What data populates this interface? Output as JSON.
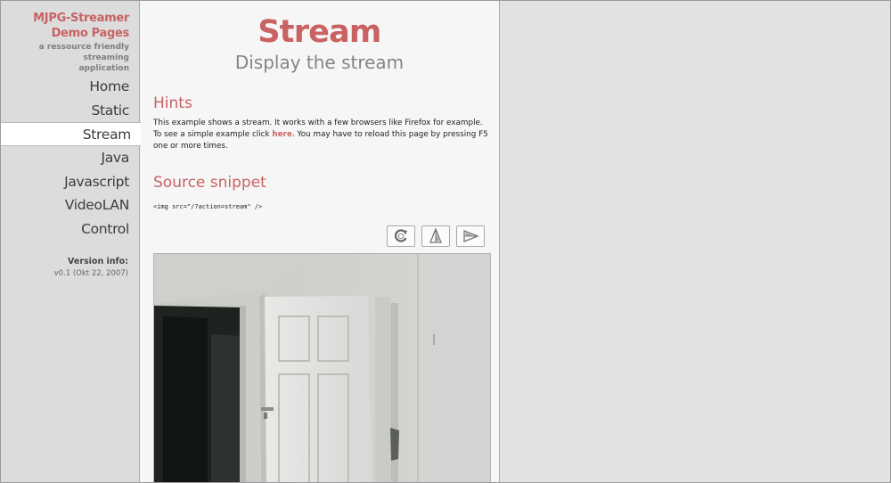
{
  "brand": {
    "title": "MJPG-Streamer\nDemo Pages",
    "subtitle": "a ressource friendly streaming\napplication"
  },
  "nav": {
    "items": [
      {
        "label": "Home"
      },
      {
        "label": "Static"
      },
      {
        "label": "Stream"
      },
      {
        "label": "Java"
      },
      {
        "label": "Javascript"
      },
      {
        "label": "VideoLAN"
      },
      {
        "label": "Control"
      }
    ],
    "active": "Stream"
  },
  "version": {
    "label": "Version info:",
    "value": "v0.1 (Okt 22, 2007)"
  },
  "page": {
    "title": "Stream",
    "subtitle": "Display the stream"
  },
  "hints": {
    "heading": "Hints",
    "text_before": "This example shows a stream. It works with a few browsers like Firefox for example. To see a simple example click ",
    "link": "here",
    "text_after": ". You may have to reload this page by pressing F5 one or more times."
  },
  "snippet": {
    "heading": "Source snippet",
    "code": "<img src=\"/?action=stream\" />"
  },
  "toolbar": {
    "buttons": [
      {
        "icon": "rotate-icon"
      },
      {
        "icon": "flip-vertical-icon"
      },
      {
        "icon": "flip-horizontal-icon"
      }
    ]
  },
  "colors": {
    "accent": "#c96262",
    "sidebar_bg": "#dcdcdc",
    "content_bg": "#f6f6f6",
    "page_bg": "#e2e2e2"
  }
}
